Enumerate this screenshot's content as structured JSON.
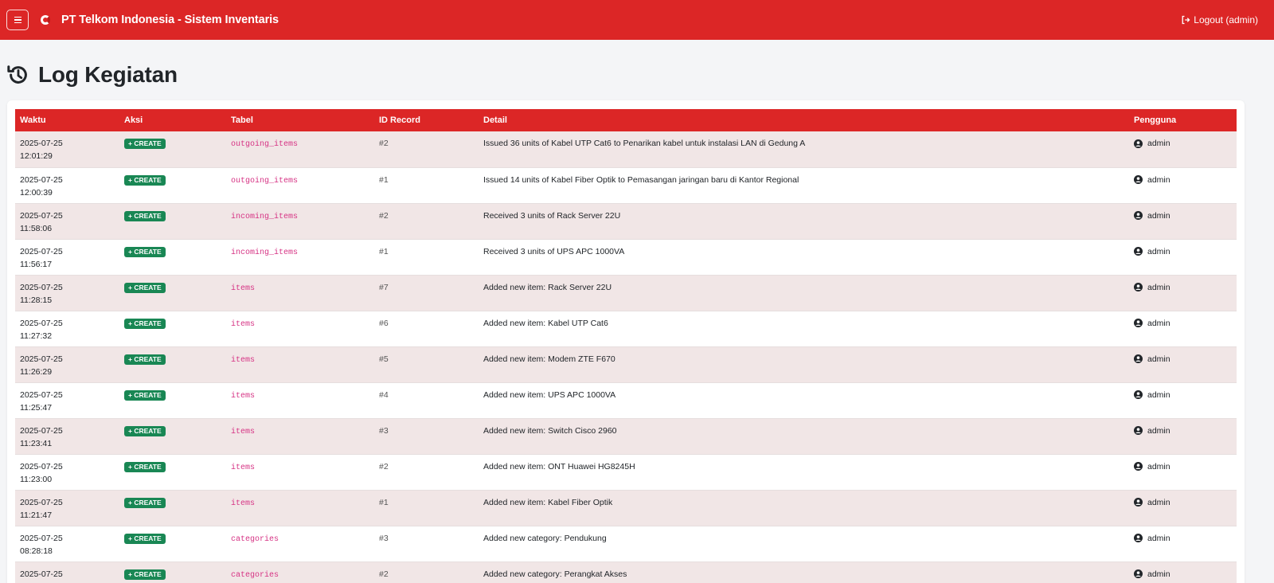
{
  "navbar": {
    "brand": "PT Telkom Indonesia - Sistem Inventaris",
    "logout": "Logout (admin)",
    "color": "#dc2626"
  },
  "page": {
    "title": "Log Kegiatan"
  },
  "table": {
    "headers": [
      "Waktu",
      "Aksi",
      "Tabel",
      "ID Record",
      "Detail",
      "Pengguna"
    ],
    "rows": [
      {
        "date": "2025-07-25",
        "time": "12:01:29",
        "action": "+ CREATE",
        "table": "outgoing_items",
        "id": "#2",
        "detail": "Issued 36 units of Kabel UTP Cat6 to Penarikan kabel untuk instalasi LAN di Gedung A",
        "user": "admin"
      },
      {
        "date": "2025-07-25",
        "time": "12:00:39",
        "action": "+ CREATE",
        "table": "outgoing_items",
        "id": "#1",
        "detail": "Issued 14 units of Kabel Fiber Optik to Pemasangan jaringan baru di Kantor Regional",
        "user": "admin"
      },
      {
        "date": "2025-07-25",
        "time": "11:58:06",
        "action": "+ CREATE",
        "table": "incoming_items",
        "id": "#2",
        "detail": "Received 3 units of Rack Server 22U",
        "user": "admin"
      },
      {
        "date": "2025-07-25",
        "time": "11:56:17",
        "action": "+ CREATE",
        "table": "incoming_items",
        "id": "#1",
        "detail": "Received 3 units of UPS APC 1000VA",
        "user": "admin"
      },
      {
        "date": "2025-07-25",
        "time": "11:28:15",
        "action": "+ CREATE",
        "table": "items",
        "id": "#7",
        "detail": "Added new item: Rack Server 22U",
        "user": "admin"
      },
      {
        "date": "2025-07-25",
        "time": "11:27:32",
        "action": "+ CREATE",
        "table": "items",
        "id": "#6",
        "detail": "Added new item: Kabel UTP Cat6",
        "user": "admin"
      },
      {
        "date": "2025-07-25",
        "time": "11:26:29",
        "action": "+ CREATE",
        "table": "items",
        "id": "#5",
        "detail": "Added new item: Modem ZTE F670",
        "user": "admin"
      },
      {
        "date": "2025-07-25",
        "time": "11:25:47",
        "action": "+ CREATE",
        "table": "items",
        "id": "#4",
        "detail": "Added new item: UPS APC 1000VA",
        "user": "admin"
      },
      {
        "date": "2025-07-25",
        "time": "11:23:41",
        "action": "+ CREATE",
        "table": "items",
        "id": "#3",
        "detail": "Added new item: Switch Cisco 2960",
        "user": "admin"
      },
      {
        "date": "2025-07-25",
        "time": "11:23:00",
        "action": "+ CREATE",
        "table": "items",
        "id": "#2",
        "detail": "Added new item: ONT Huawei HG8245H",
        "user": "admin"
      },
      {
        "date": "2025-07-25",
        "time": "11:21:47",
        "action": "+ CREATE",
        "table": "items",
        "id": "#1",
        "detail": "Added new item: Kabel Fiber Optik",
        "user": "admin"
      },
      {
        "date": "2025-07-25",
        "time": "08:28:18",
        "action": "+ CREATE",
        "table": "categories",
        "id": "#3",
        "detail": "Added new category: Pendukung",
        "user": "admin"
      },
      {
        "date": "2025-07-25",
        "time": "",
        "action": "+ CREATE",
        "table": "categories",
        "id": "#2",
        "detail": "Added new category: Perangkat Akses",
        "user": "admin"
      }
    ]
  },
  "icons": {
    "menu": "hamburger-icon",
    "logo": "telkom-logo",
    "logout": "sign-out-icon",
    "history": "history-icon",
    "user": "user-circle-icon"
  },
  "colors": {
    "badge_create": "#198754",
    "table_name": "#d63384",
    "row_odd": "#f1e6e6"
  }
}
